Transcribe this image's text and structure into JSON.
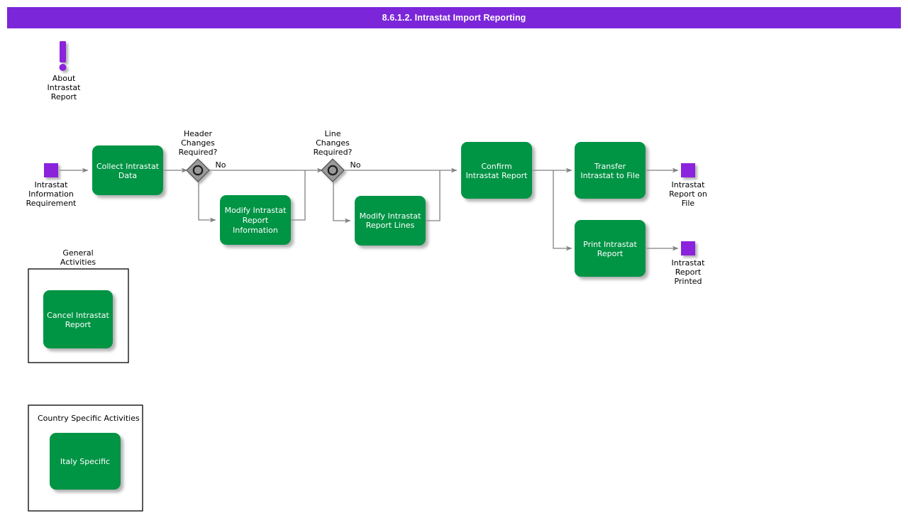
{
  "header": {
    "title": "8.6.1.2. Intrastat Import Reporting",
    "bar_color": "#7b26d9",
    "text_color": "#ffffff"
  },
  "theme": {
    "activity_fill": "#009444",
    "activity_text": "#ffffff",
    "terminator_fill": "#8b24dc",
    "gateway_fill": "#999999",
    "gateway_stroke": "#4d4d4d",
    "connector_color": "#808080",
    "group_border": "#000000",
    "page_background": "#ffffff"
  },
  "info_note": {
    "icon": "exclamation-icon",
    "label_lines": [
      "About",
      "Intrastat",
      "Report"
    ],
    "color": "#8b24dc"
  },
  "nodes": {
    "start_event": {
      "type": "terminator",
      "label_lines": [
        "Intrastat",
        "Information",
        "Requirement"
      ]
    },
    "collect": {
      "type": "activity",
      "label_lines": [
        "Collect Intrastat",
        "Data"
      ]
    },
    "gateway_header": {
      "type": "gateway",
      "label_lines": [
        "Header",
        "Changes",
        "Required?"
      ],
      "branch_label": "No"
    },
    "modify_header": {
      "type": "activity",
      "label_lines": [
        "Modify Intrastat",
        "Report",
        "Information"
      ]
    },
    "gateway_line": {
      "type": "gateway",
      "label_lines": [
        "Line",
        "Changes",
        "Required?"
      ],
      "branch_label": "No"
    },
    "modify_lines": {
      "type": "activity",
      "label_lines": [
        "Modify Intrastat",
        "Report Lines"
      ]
    },
    "confirm": {
      "type": "activity",
      "label_lines": [
        "Confirm",
        "Intrastat Report"
      ]
    },
    "transfer": {
      "type": "activity",
      "label_lines": [
        "Transfer",
        "Intrastat to File"
      ]
    },
    "print": {
      "type": "activity",
      "label_lines": [
        "Print Intrastat",
        "Report"
      ]
    },
    "end_file": {
      "type": "terminator",
      "label_lines": [
        "Intrastat",
        "Report on",
        "File"
      ]
    },
    "end_printed": {
      "type": "terminator",
      "label_lines": [
        "Intrastat",
        "Report",
        "Printed"
      ]
    }
  },
  "groups": {
    "general": {
      "title_lines": [
        "General",
        "Activities"
      ],
      "title_position": "above",
      "items": [
        {
          "label_lines": [
            "Cancel Intrastat",
            "Report"
          ]
        }
      ]
    },
    "country_specific": {
      "title_lines": [
        "Country Specific Activities"
      ],
      "title_position": "inside-top-left",
      "items": [
        {
          "label_lines": [
            "Italy Specific"
          ]
        }
      ]
    }
  }
}
